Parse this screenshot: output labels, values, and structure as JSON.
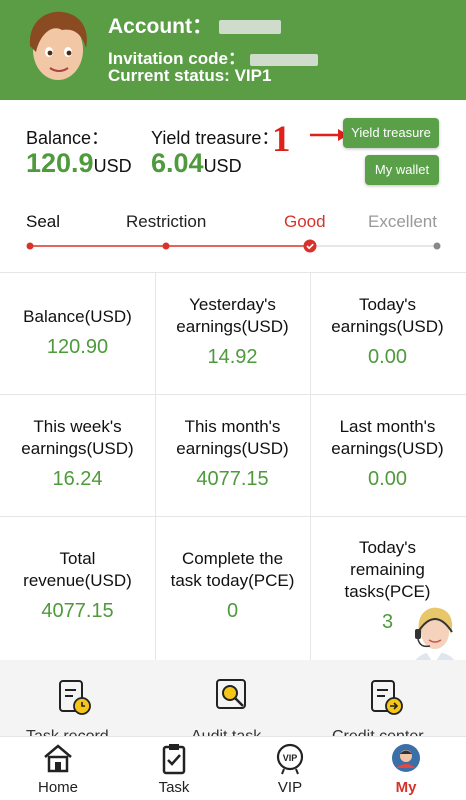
{
  "header": {
    "account_label": "Account：",
    "invitation_label": "Invitation code：",
    "status_text": "Current status: VIP1",
    "bg_color": "#5a9d45"
  },
  "summary": {
    "balance_label": "Balance：",
    "balance_value": "120.9",
    "balance_unit": "USD",
    "yield_label": "Yield treasure：",
    "yield_value": "6.04",
    "yield_unit": "USD",
    "yield_button": "Yield treasure",
    "wallet_button": "My wallet",
    "annotation_number": "1"
  },
  "levels": [
    {
      "label": "Seal"
    },
    {
      "label": "Restriction"
    },
    {
      "label": "Good"
    },
    {
      "label": "Excellent"
    }
  ],
  "stats": [
    {
      "title": "Balance(USD)",
      "value": "120.90"
    },
    {
      "title": "Yesterday's earnings(USD)",
      "value": "14.92"
    },
    {
      "title": "Today's earnings(USD)",
      "value": "0.00"
    },
    {
      "title": "This week's earnings(USD)",
      "value": "16.24"
    },
    {
      "title": "This month's earnings(USD)",
      "value": "4077.15"
    },
    {
      "title": "Last month's earnings(USD)",
      "value": "0.00"
    },
    {
      "title": "Total revenue(USD)",
      "value": "4077.15"
    },
    {
      "title": "Complete the task today(PCE)",
      "value": "0"
    },
    {
      "title": "Today's remaining tasks(PCE)",
      "value": "3"
    }
  ],
  "shortcuts": [
    {
      "icon": "task-record-icon",
      "label": "Task record"
    },
    {
      "icon": "audit-task-icon",
      "label": "Audit task"
    },
    {
      "icon": "credit-center-icon",
      "label": "Credit center"
    }
  ],
  "nav": [
    {
      "icon": "home-icon",
      "label": "Home"
    },
    {
      "icon": "task-icon",
      "label": "Task"
    },
    {
      "icon": "vip-icon",
      "label": "VIP"
    },
    {
      "icon": "profile-icon",
      "label": "My"
    }
  ],
  "colors": {
    "accent": "#4e9a3c",
    "alert": "#d9322b",
    "button": "#5aa048"
  }
}
